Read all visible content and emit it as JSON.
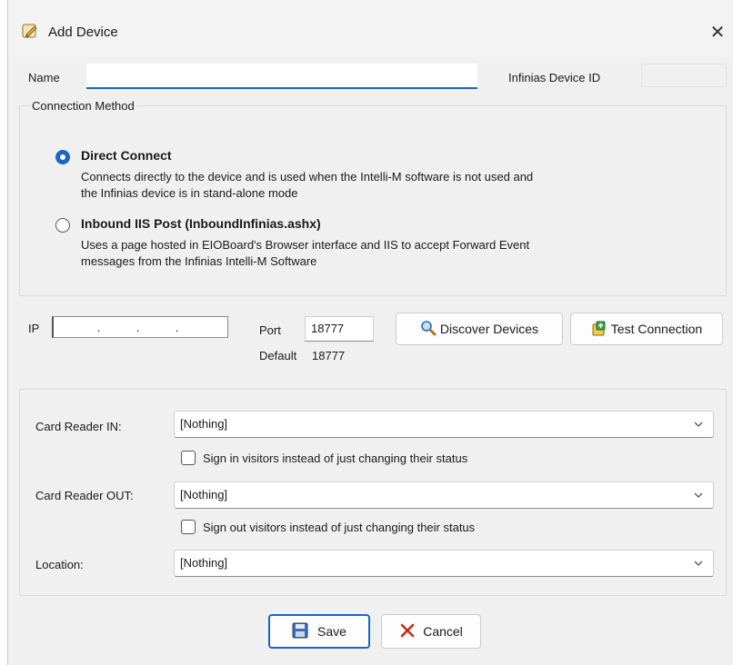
{
  "window": {
    "title": "Add Device",
    "close_glyph": "✕"
  },
  "fields": {
    "name_label": "Name",
    "name_value": "",
    "device_id_label": "Infinias Device ID"
  },
  "connection": {
    "group_label": "Connection Method",
    "options": [
      {
        "title": "Direct Connect",
        "desc_line1": "Connects directly to the device and is used when the Intelli-M software is not used and",
        "desc_line2": "the Infinias device is in stand-alone mode",
        "selected": true
      },
      {
        "title": "Inbound IIS Post (InboundInfinias.ashx)",
        "desc_line1": "Uses a page hosted in EIOBoard's Browser interface and IIS to accept Forward Event",
        "desc_line2": "messages from the Infinias Intelli-M Software",
        "selected": false
      }
    ]
  },
  "network": {
    "ip_label": "IP",
    "ip_dots": [
      ".",
      ".",
      "."
    ],
    "port_label": "Port",
    "port_value": "18777",
    "default_label": "Default",
    "default_value": "18777",
    "discover_label": "Discover Devices",
    "test_label": "Test Connection"
  },
  "readers": {
    "card_in_label": "Card Reader IN:",
    "card_in_value": "[Nothing]",
    "sign_in_label": "Sign in visitors instead of just changing their status",
    "card_out_label": "Card Reader OUT:",
    "card_out_value": "[Nothing]",
    "sign_out_label": "Sign out visitors instead of just changing their status",
    "location_label": "Location:",
    "location_value": "[Nothing]"
  },
  "footer": {
    "save_label": "Save",
    "cancel_label": "Cancel"
  },
  "colors": {
    "accent": "#1a66c2",
    "window_bg": "#f0f0f0",
    "cancel_red": "#c42b1c"
  }
}
